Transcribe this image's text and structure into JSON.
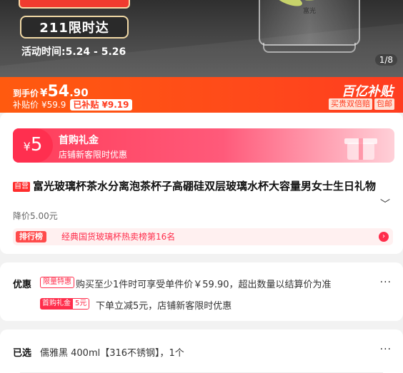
{
  "hero": {
    "promo_box": "211限时达",
    "promo_time": "活动时间:5.24 - 5.26",
    "glass_brand": "富光",
    "pager": "1/8"
  },
  "price": {
    "label": "到手价",
    "currency": "¥",
    "integer": "54",
    "decimal": ".90",
    "subsidy_label": "补贴价",
    "subsidy_value": "¥59.9",
    "subsidy_tag": "已补贴 ¥9.19",
    "brand_logo": "百亿补贴",
    "badges": [
      "买贵双倍赔",
      "包邮"
    ]
  },
  "coupon": {
    "currency": "¥",
    "amount": "5",
    "title": "首购礼金",
    "subtitle": "店铺新客限时优惠"
  },
  "product": {
    "tag": "自营",
    "title": "富光玻璃杯茶水分离泡茶杯子高硼硅双层玻璃水杯大容量男女士生日礼物",
    "original_price": "降价5.00元",
    "rank_tag": "排行榜",
    "rank_text": "经典国货玻璃杯热卖榜第16名"
  },
  "promo": {
    "heading": "优惠",
    "tag1": "限量特惠",
    "line1": "购买至少1件时可享受单件价￥59.90，超出数量以结算价为准",
    "tag2_a": "首购礼金",
    "tag2_b": "5元",
    "line2": "下单立减5元，店铺新客限时优惠",
    "more": "···"
  },
  "selected": {
    "heading": "已选",
    "value": "儒雅黑 400ml【316不锈钢】，1个",
    "more": "···"
  },
  "colors": {
    "accent": "#ff4a1a",
    "coupon": "#ff3d5a",
    "rank": "#ff2d4b"
  }
}
